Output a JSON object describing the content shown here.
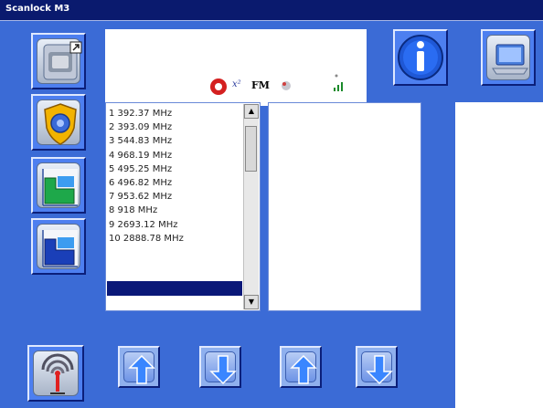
{
  "window": {
    "title": "Scanlock M3"
  },
  "status_strip": {
    "fm_label": "FM",
    "exponent_label": "x²",
    "icons": [
      "record-icon",
      "fm-signal-icon",
      "signal-strength-icon"
    ]
  },
  "frequency_list": {
    "items": [
      "1 392.37 MHz",
      "2 393.09 MHz",
      "3 544.83 MHz",
      "4 968.19 MHz",
      "5 495.25 MHz",
      "6 496.82 MHz",
      "7 953.62 MHz",
      "8 918 MHz",
      "9 2693.12 MHz",
      "10 2888.78 MHz"
    ],
    "scroll_up": "▲",
    "scroll_down": "▼"
  },
  "toolbar": {
    "left_buttons": [
      "scanner-device-icon",
      "shield-settings-icon",
      "green-chart-icon",
      "blue-chart-icon"
    ],
    "top_buttons": [
      "info-icon",
      "laptop-icon"
    ],
    "bottom_buttons": [
      "antenna-icon",
      "arrow-up-icon",
      "arrow-down-icon",
      "arrow-up-icon",
      "arrow-down-icon"
    ]
  },
  "colors": {
    "background": "#3b6bd6",
    "titlebar": "#0a1a6e",
    "selection": "#0a1878"
  }
}
